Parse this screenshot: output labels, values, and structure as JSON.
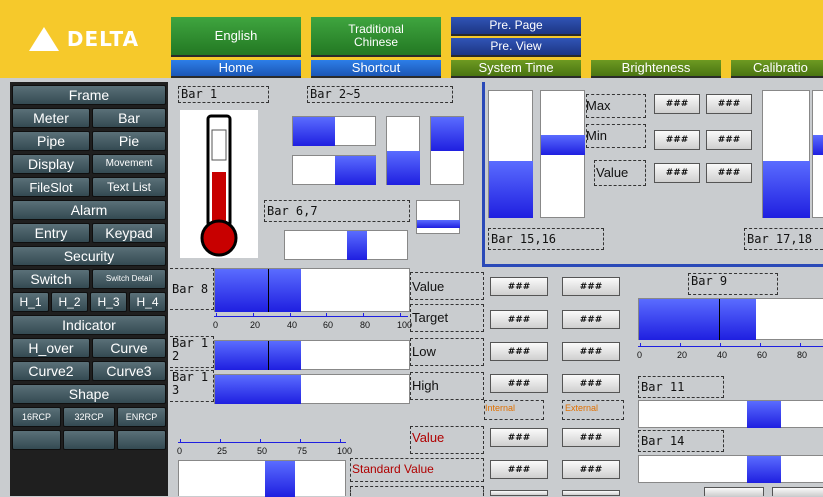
{
  "brand": {
    "name": "DELTA",
    "yellow": "#f6c92b"
  },
  "top": {
    "english": "English",
    "traditional": "Traditional",
    "chinese": "Chinese",
    "pre_page": "Pre. Page",
    "pre_view": "Pre. View",
    "home": "Home",
    "shortcut": "Shortcut",
    "system_time": "System Time",
    "brighteness": "Brighteness",
    "calibration": "Calibratio"
  },
  "side": {
    "frame": "Frame",
    "meter": "Meter",
    "bar": "Bar",
    "pipe": "Pipe",
    "pie": "Pie",
    "display": "Display",
    "movement": "Movement",
    "fileslot": "FileSlot",
    "textlist": "Text List",
    "alarm": "Alarm",
    "entry": "Entry",
    "keypad": "Keypad",
    "security": "Security",
    "switch": "Switch",
    "switch_detail": "Switch Detail",
    "h1": "H_1",
    "h2": "H_2",
    "h3": "H_3",
    "h4": "H_4",
    "indicator": "Indicator",
    "hover": "H_over",
    "curve": "Curve",
    "curve2": "Curve2",
    "curve3": "Curve3",
    "shape": "Shape",
    "rcp16": "16RCP",
    "rcp32": "32RCP",
    "enrcp": "ENRCP"
  },
  "labels": {
    "bar1": "Bar 1",
    "bar2_5": "Bar 2~5",
    "bar6_7": "Bar 6,7",
    "bar15_16": "Bar 15,16",
    "bar17_18": "Bar 17,18",
    "bar8": "Bar 8",
    "bar9": "Bar 9",
    "bar11": "Bar 11",
    "bar14": "Bar 14",
    "bar1_2": "Bar 1",
    "bar1_3": "Bar 1",
    "bar1_2_suffix": "2",
    "bar1_3_suffix": "3"
  },
  "stats": {
    "max": "Max",
    "min": "Min",
    "value": "Value",
    "target": "Target",
    "low": "Low",
    "high": "High",
    "value2": "Value",
    "standard": "Standard Value",
    "internal": "Internal",
    "external": "External",
    "hash": "###"
  },
  "scales": {
    "a": [
      "0",
      "20",
      "40",
      "60",
      "80",
      "100"
    ],
    "b": [
      "0",
      "20",
      "40",
      "60",
      "80"
    ],
    "c": [
      "0",
      "25",
      "50",
      "75",
      "100"
    ]
  },
  "levels": {
    "bar8": 0.44,
    "bar8_marker": 0.27,
    "barA": 0.44,
    "barA_marker": 0.27,
    "barB": 0.44,
    "bar9": 0.63,
    "bar9_marker": 0.43,
    "thermo": 0.56,
    "bar15": 0.45,
    "bar16": 0.28,
    "bar17": 0.45
  }
}
